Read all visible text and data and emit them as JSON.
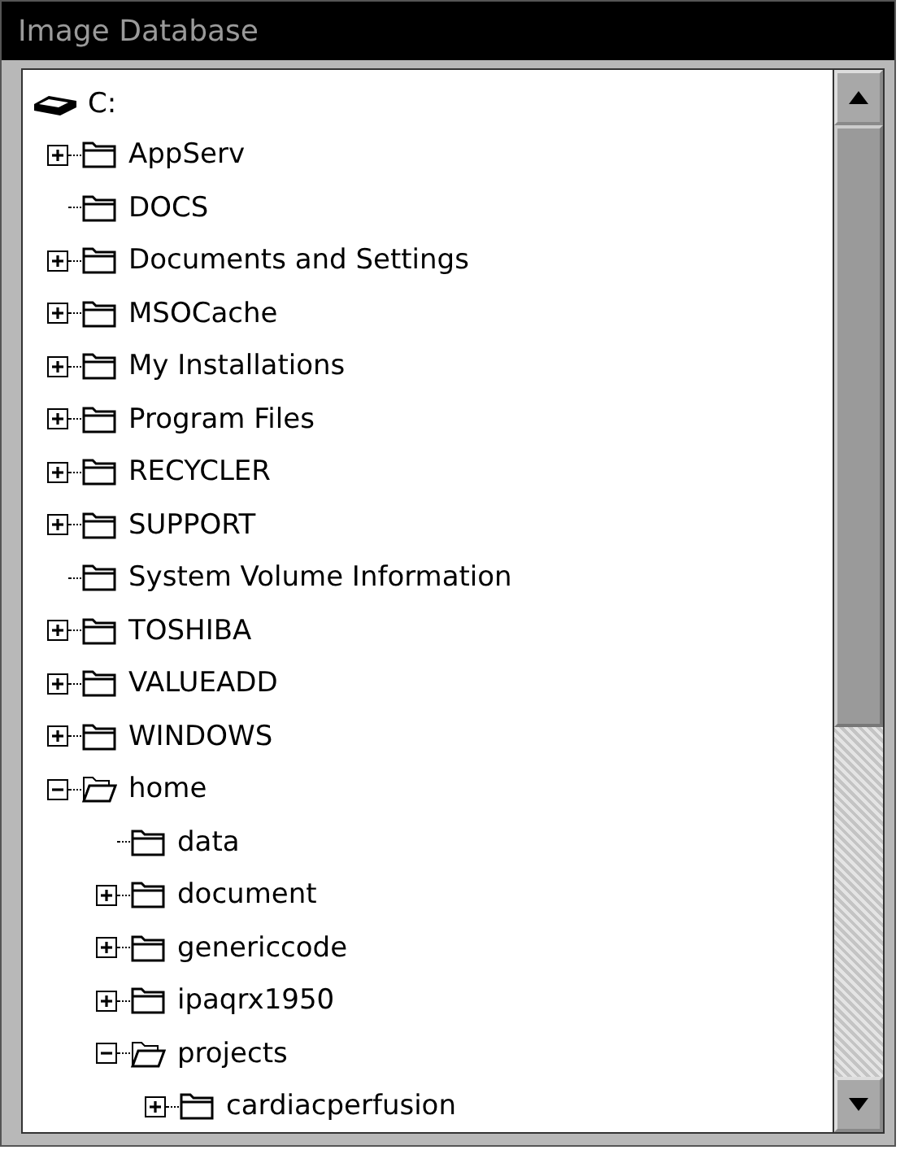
{
  "window": {
    "title": "Image Database"
  },
  "tree": {
    "root": {
      "label": "C:",
      "children": [
        {
          "label": "AppServ",
          "has_children": true,
          "expanded": false
        },
        {
          "label": "DOCS",
          "has_children": false,
          "expanded": false
        },
        {
          "label": "Documents and Settings",
          "has_children": true,
          "expanded": false
        },
        {
          "label": "MSOCache",
          "has_children": true,
          "expanded": false
        },
        {
          "label": "My Installations",
          "has_children": true,
          "expanded": false
        },
        {
          "label": "Program Files",
          "has_children": true,
          "expanded": false
        },
        {
          "label": "RECYCLER",
          "has_children": true,
          "expanded": false
        },
        {
          "label": "SUPPORT",
          "has_children": true,
          "expanded": false
        },
        {
          "label": "System Volume Information",
          "has_children": false,
          "expanded": false
        },
        {
          "label": "TOSHIBA",
          "has_children": true,
          "expanded": false
        },
        {
          "label": "VALUEADD",
          "has_children": true,
          "expanded": false
        },
        {
          "label": "WINDOWS",
          "has_children": true,
          "expanded": false
        },
        {
          "label": "home",
          "has_children": true,
          "expanded": true,
          "children": [
            {
              "label": "data",
              "has_children": false,
              "expanded": false
            },
            {
              "label": "document",
              "has_children": true,
              "expanded": false
            },
            {
              "label": "genericcode",
              "has_children": true,
              "expanded": false
            },
            {
              "label": "ipaqrx1950",
              "has_children": true,
              "expanded": false
            },
            {
              "label": "projects",
              "has_children": true,
              "expanded": true,
              "children": [
                {
                  "label": "cardiacperfusion",
                  "has_children": true,
                  "expanded": false
                }
              ]
            }
          ]
        }
      ]
    }
  }
}
